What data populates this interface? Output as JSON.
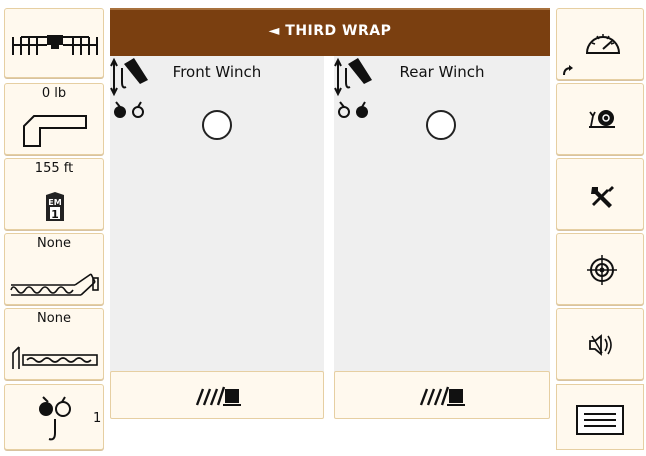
{
  "header": {
    "title": "THIRD WRAP",
    "back_arrow": "◄"
  },
  "panels": [
    {
      "title": "Front Winch",
      "indicator": "off"
    },
    {
      "title": "Rear Winch",
      "indicator": "off"
    }
  ],
  "left_tiles": [
    {
      "label": "",
      "icon": "crane-configuration-icon"
    },
    {
      "label": "0 lb",
      "icon": "jib-offset-icon"
    },
    {
      "label": "155 ft",
      "icon": "em1-boom-icon"
    },
    {
      "label": "None",
      "icon": "fly-jib-icon"
    },
    {
      "label": "None",
      "icon": "boom-extension-icon"
    },
    {
      "label": "1",
      "icon": "hook-block-icon"
    }
  ],
  "right_tiles": [
    {
      "icon": "speedometer-icon"
    },
    {
      "icon": "snail-slow-speed-icon"
    },
    {
      "icon": "tools-icon"
    },
    {
      "icon": "target-icon"
    },
    {
      "icon": "speaker-mute-icon"
    },
    {
      "icon": "menu-icon"
    }
  ],
  "colors": {
    "header": "#7a3f10",
    "tile_bg": "#fff9ee",
    "tile_border": "#e6cfa2",
    "panel_bg": "#efefef"
  }
}
